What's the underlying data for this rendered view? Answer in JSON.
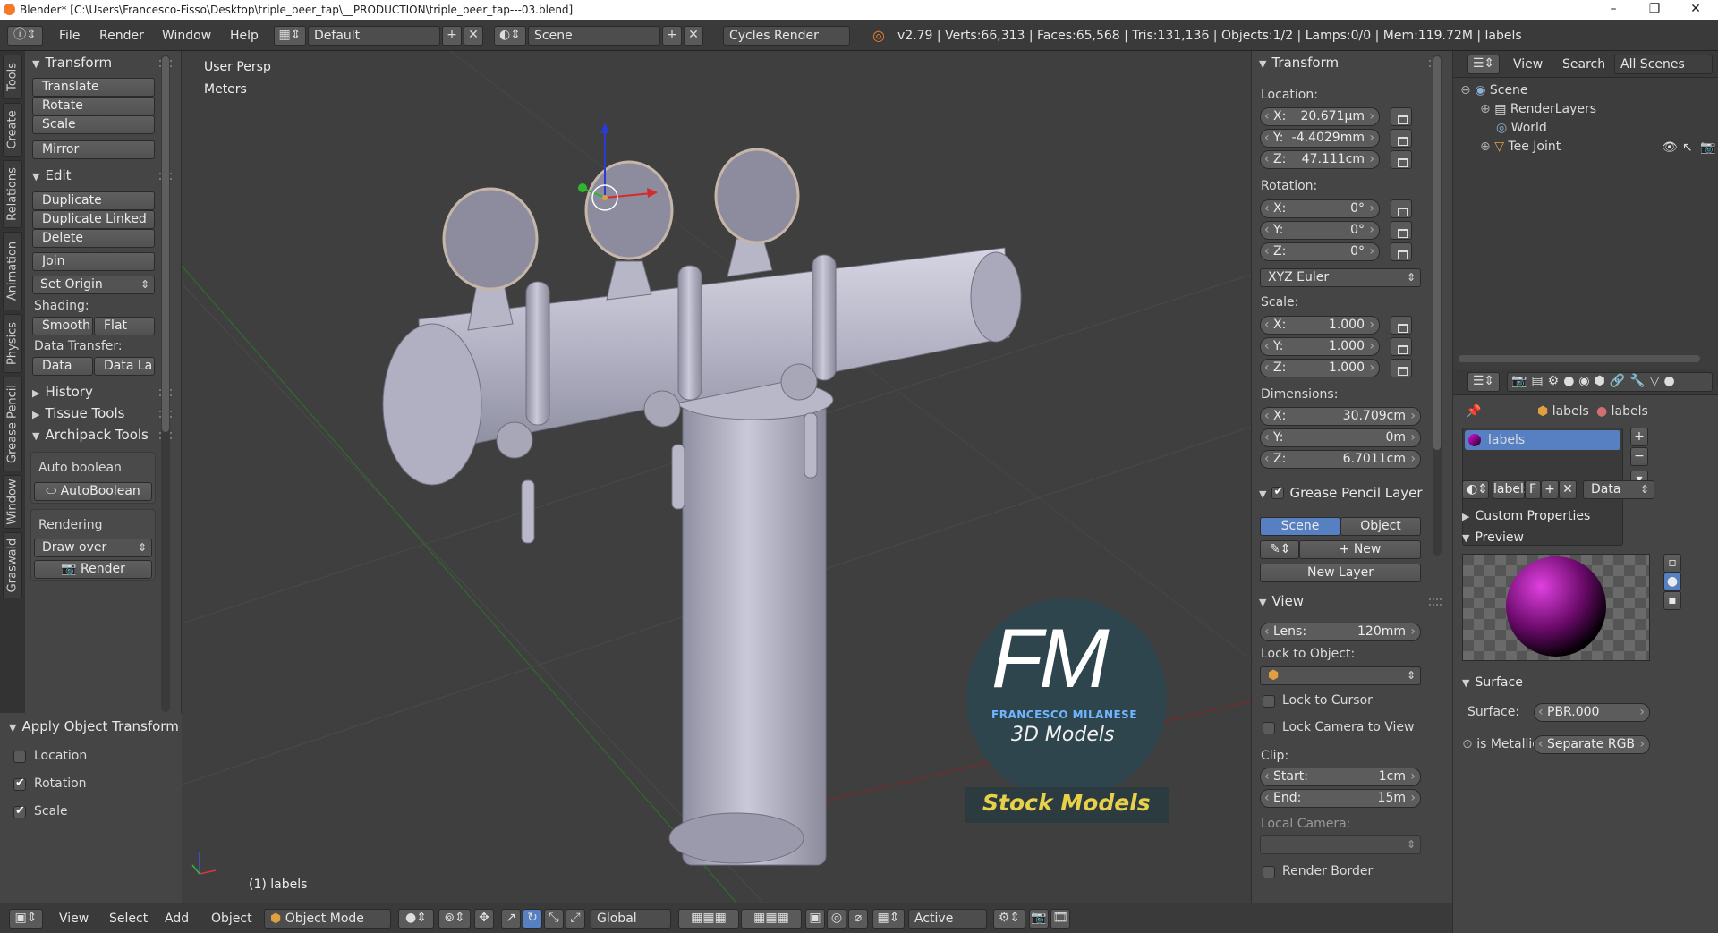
{
  "window": {
    "title": "Blender* [C:\\Users\\Francesco-Fisso\\Desktop\\triple_beer_tap\\__PRODUCTION\\triple_beer_tap---03.blend]",
    "min": "–",
    "max": "❐",
    "close": "✕"
  },
  "infobar": {
    "menus": [
      "File",
      "Render",
      "Window",
      "Help"
    ],
    "layout": "Default",
    "scene": "Scene",
    "engine": "Cycles Render",
    "stats": "v2.79 | Verts:66,313 | Faces:65,568 | Tris:131,136 | Objects:1/2 | Lamps:0/0 | Mem:119.72M | labels"
  },
  "left_tabs": [
    "Tools",
    "Create",
    "Relations",
    "Animation",
    "Physics",
    "Grease Pencil",
    "Window",
    "Graswald"
  ],
  "toolshelf": {
    "transform": {
      "title": "Transform",
      "buttons": [
        "Translate",
        "Rotate",
        "Scale",
        "Mirror"
      ]
    },
    "edit": {
      "title": "Edit",
      "buttons": [
        "Duplicate",
        "Duplicate Linked",
        "Delete",
        "Join"
      ],
      "set_origin": "Set Origin",
      "shading_label": "Shading:",
      "smooth": "Smooth",
      "flat": "Flat",
      "data_transfer_label": "Data Transfer:",
      "data": "Data",
      "data_la": "Data La"
    },
    "history": "History",
    "tissue": "Tissue Tools",
    "archipack": "Archipack Tools",
    "auto_boolean_label": "Auto boolean",
    "auto_boolean_btn": "AutoBoolean",
    "rendering_label": "Rendering",
    "draw_over": "Draw over",
    "render_btn": "Render"
  },
  "operator_panel": {
    "title": "Apply Object Transform",
    "location": "Location",
    "rotation": "Rotation",
    "scale": "Scale",
    "checks": {
      "location": false,
      "rotation": true,
      "scale": true
    }
  },
  "viewport": {
    "view_name": "User Persp",
    "units": "Meters",
    "object_label": "(1) labels",
    "watermark": {
      "fm": "FM",
      "author": "FRANCESCO MILANESE",
      "models": "3D Models",
      "stock": "Stock Models"
    }
  },
  "npanel": {
    "transform_title": "Transform",
    "location_label": "Location:",
    "loc": {
      "x": "20.671µm",
      "y": "-4.4029mm",
      "z": "47.111cm"
    },
    "rotation_label": "Rotation:",
    "rot": {
      "x": "0°",
      "y": "0°",
      "z": "0°"
    },
    "rot_mode": "XYZ Euler",
    "scale_label": "Scale:",
    "scl": {
      "x": "1.000",
      "y": "1.000",
      "z": "1.000"
    },
    "dimensions_label": "Dimensions:",
    "dim": {
      "x": "30.709cm",
      "y": "0m",
      "z": "6.7011cm"
    },
    "axis": {
      "x": "X:",
      "y": "Y:",
      "z": "Z:"
    },
    "gp_title": "Grease Pencil Layer",
    "gp_scene": "Scene",
    "gp_object": "Object",
    "gp_new": "New",
    "gp_new_layer": "New Layer",
    "view_title": "View",
    "lens_label": "Lens:",
    "lens": "120mm",
    "lock_obj_label": "Lock to Object:",
    "lock_cursor": "Lock to Cursor",
    "lock_camera": "Lock Camera to View",
    "clip_label": "Clip:",
    "start_label": "Start:",
    "start": "1cm",
    "end_label": "End:",
    "end": "15m",
    "local_camera": "Local Camera:",
    "render_border": "Render Border"
  },
  "outliner": {
    "view": "View",
    "search": "Search",
    "all_scenes": "All Scenes",
    "items": [
      "Scene",
      "RenderLayers",
      "World",
      "Tee Joint"
    ]
  },
  "properties": {
    "bc_obj": "labels",
    "bc_mat": "labels",
    "slot": "labels",
    "mat_name": "labels",
    "f": "F",
    "data": "Data",
    "custom_props": "Custom Properties",
    "preview": "Preview",
    "surface_title": "Surface",
    "surface_label": "Surface:",
    "surface_val": "PBR.000",
    "metallic_label": "is Metallic",
    "metallic_val": "Separate RGB"
  },
  "bottombar": {
    "menus": [
      "View",
      "Select",
      "Add",
      "Object"
    ],
    "mode": "Object Mode",
    "orientation": "Global",
    "layer": "Active"
  },
  "colors": {
    "accent": "#5680c2",
    "viewport": "#3f3f3f",
    "panel": "#454545"
  }
}
